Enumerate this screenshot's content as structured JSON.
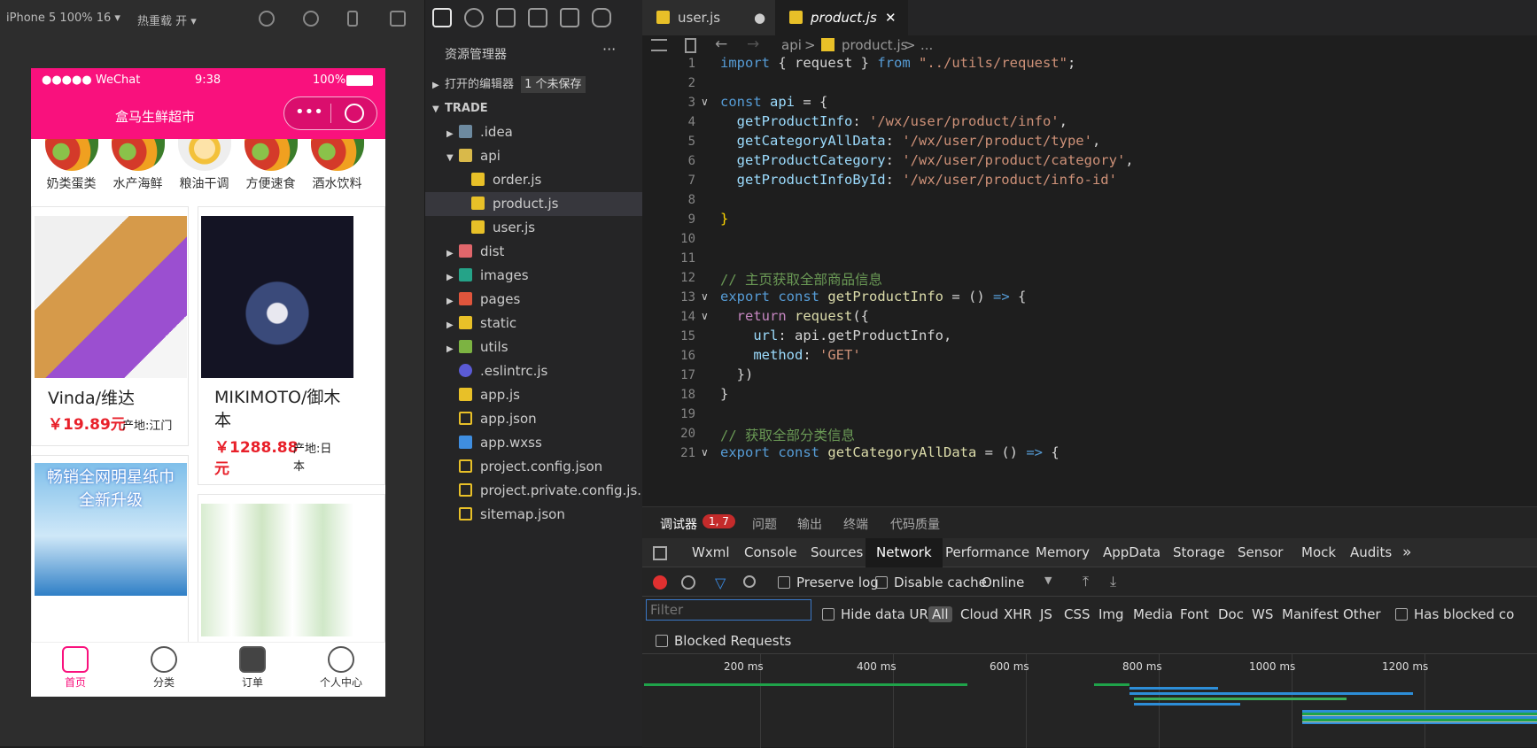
{
  "simulator": {
    "device": "iPhone 5 100% 16 ▾",
    "hotreload": "热重载 开 ▾",
    "status": {
      "carrier": "●●●●● WeChat",
      "time": "9:38",
      "battery": "100%"
    },
    "nav_title": "盒马生鲜超市",
    "categories": [
      "奶类蛋类",
      "水产海鲜",
      "粮油干调",
      "方便速食",
      "酒水饮料"
    ],
    "products": [
      {
        "name": "Vinda/维达",
        "price": "￥19.89元",
        "origin": "产地:江门"
      },
      {
        "name": "MIKIMOTO/御木本",
        "price": "￥1288.88元",
        "origin": "产地:日本"
      }
    ],
    "banner_text": [
      "畅销全网明星纸巾",
      "全新升级"
    ],
    "tabs": [
      "首页",
      "分类",
      "订单",
      "个人中心"
    ]
  },
  "explorer": {
    "title": "资源管理器",
    "more": "···",
    "open_editors": "打开的编辑器",
    "unsaved": "1 个未保存",
    "project": "TRADE",
    "items": [
      ".idea",
      "api",
      "order.js",
      "product.js",
      "user.js",
      "dist",
      "images",
      "pages",
      "static",
      "utils",
      ".eslintrc.js",
      "app.js",
      "app.json",
      "app.wxss",
      "project.config.json",
      "project.private.config.js...",
      "sitemap.json"
    ]
  },
  "editor": {
    "tabs": [
      "user.js",
      "product.js"
    ],
    "tab_dirty": "●",
    "tab_close": "✕",
    "breadcrumb": [
      "api",
      ">",
      "product.js",
      ">",
      "..."
    ],
    "lines": [
      "1",
      "2",
      "3",
      "4",
      "5",
      "6",
      "7",
      "8",
      "9",
      "10",
      "11",
      "12",
      "13",
      "14",
      "15",
      "16",
      "17",
      "18",
      "19",
      "20",
      "21"
    ]
  },
  "devtools": {
    "top_tabs": [
      "调试器",
      "问题",
      "输出",
      "终端",
      "代码质量"
    ],
    "badge": "1, 7",
    "tabs": [
      "Wxml",
      "Console",
      "Sources",
      "Network",
      "Performance",
      "Memory",
      "AppData",
      "Storage",
      "Sensor",
      "Mock",
      "Audits"
    ],
    "more": "»",
    "preserve_log": "Preserve log",
    "disable_cache": "Disable cache",
    "throttle": "Online",
    "filter_placeholder": "Filter",
    "hide_data_urls": "Hide data URLs",
    "filter_types": [
      "All",
      "Cloud",
      "XHR",
      "JS",
      "CSS",
      "Img",
      "Media",
      "Font",
      "Doc",
      "WS",
      "Manifest",
      "Other"
    ],
    "has_blocked": "Has blocked co",
    "blocked_requests": "Blocked Requests",
    "timeline": [
      "200 ms",
      "400 ms",
      "600 ms",
      "800 ms",
      "1000 ms",
      "1200 ms"
    ]
  },
  "colors": {
    "brand": "#f9117d",
    "price": "#e8202a",
    "network_on": "#1a1a1a"
  }
}
